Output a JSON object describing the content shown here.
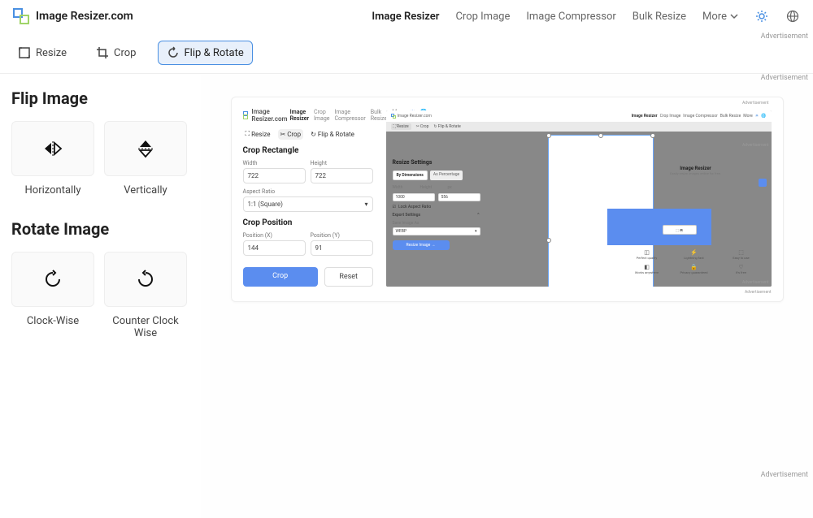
{
  "header": {
    "logo_text": "Image Resizer.com",
    "nav": [
      {
        "label": "Image Resizer",
        "active": true
      },
      {
        "label": "Crop Image"
      },
      {
        "label": "Image Compressor"
      },
      {
        "label": "Bulk Resize"
      },
      {
        "label": "More"
      }
    ]
  },
  "toolbar": {
    "resize": "Resize",
    "crop": "Crop",
    "flip_rotate": "Flip & Rotate",
    "ad_label": "Advertisement"
  },
  "sidebar": {
    "flip_title": "Flip Image",
    "flip_h": "Horizontally",
    "flip_v": "Vertically",
    "rotate_title": "Rotate Image",
    "rotate_cw": "Clock-Wise",
    "rotate_ccw": "Counter Clock Wise"
  },
  "preview": {
    "header": {
      "logo_text": "Image Resizer.com",
      "nav": [
        "Image Resizer",
        "Crop Image",
        "Image Compressor",
        "Bulk Resize",
        "More"
      ]
    },
    "toolbar": {
      "resize": "Resize",
      "crop": "Crop",
      "flip": "Flip & Rotate"
    },
    "crop_rect_title": "Crop Rectangle",
    "width_label": "Width",
    "width_value": "722",
    "height_label": "Height",
    "height_value": "722",
    "aspect_label": "Aspect Ratio",
    "aspect_value": "1:1 (Square)",
    "crop_pos_title": "Crop Position",
    "posx_label": "Position (X)",
    "posx_value": "144",
    "posy_label": "Position (Y)",
    "posy_value": "91",
    "crop_btn": "Crop",
    "reset_btn": "Reset",
    "inner": {
      "logo": "Image Resizer.com",
      "nav": [
        "Image Resizer",
        "Crop Image",
        "Image Compressor",
        "Bulk Resize",
        "More"
      ],
      "tools": [
        "Resize",
        "Crop",
        "Flip & Rotate"
      ],
      "resize_title": "Resize Settings",
      "tab_dim": "By Dimensions",
      "tab_pct": "As Percentage",
      "w_lbl": "Width",
      "h_lbl": "Height",
      "w_v": "1000",
      "h_v": "556",
      "px": "px",
      "lock": "Lock Aspect Ratio",
      "export_title": "Export Settings",
      "save_as": "Save Image As",
      "save_v": "WEBP",
      "resize_btn": "Resize Image",
      "hero_t": "Image Resizer",
      "hero_s": "Easily resize images online for free."
    },
    "ad": "Advertisement"
  },
  "ad_bottom": "Advertisement"
}
